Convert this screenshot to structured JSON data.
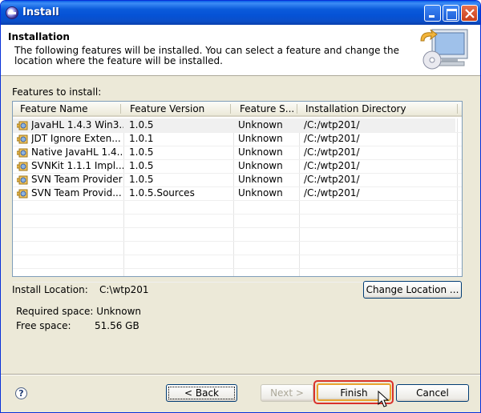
{
  "window": {
    "title": "Install"
  },
  "banner": {
    "title": "Installation",
    "description": "The following features will be installed. You can select a feature and change the location where the feature will be installed."
  },
  "features_label": "Features to install:",
  "table": {
    "columns": [
      "Feature Name",
      "Feature Version",
      "Feature S...",
      "Installation Directory"
    ],
    "rows": [
      [
        "JavaHL 1.4.3 Win3...",
        "1.0.5",
        "Unknown",
        "/C:/wtp201/"
      ],
      [
        "JDT Ignore Exten...",
        "1.0.1",
        "Unknown",
        "/C:/wtp201/"
      ],
      [
        "Native JavaHL 1.4...",
        "1.0.5",
        "Unknown",
        "/C:/wtp201/"
      ],
      [
        "SVNKit 1.1.1 Impl...",
        "1.0.5",
        "Unknown",
        "/C:/wtp201/"
      ],
      [
        "SVN Team Provider",
        "1.0.5",
        "Unknown",
        "/C:/wtp201/"
      ],
      [
        "SVN Team Provid...",
        "1.0.5.Sources",
        "Unknown",
        "/C:/wtp201/"
      ]
    ],
    "selected_row": 0
  },
  "install_location": {
    "label": "Install Location:",
    "value": "C:\\wtp201",
    "button": "Change Location ..."
  },
  "space": {
    "required": "Required space: Unknown",
    "free_label": "Free space:",
    "free_value": "51.56 GB"
  },
  "footer": {
    "help": "?",
    "back": "< Back",
    "next": "Next >",
    "finish": "Finish",
    "cancel": "Cancel"
  },
  "colors": {
    "titlebar": "#0552d6",
    "dialog_bg": "#ece9d8",
    "highlight_border": "#d9322a"
  }
}
